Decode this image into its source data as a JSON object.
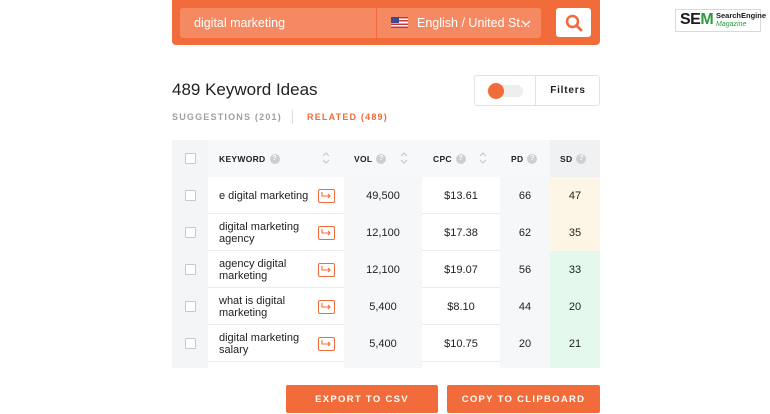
{
  "search": {
    "query": "digital marketing",
    "language": "English / United St...",
    "flag_icon": "us-flag-icon",
    "search_icon": "magnifier-icon"
  },
  "logo": {
    "sem": "SE",
    "sem_m": "M",
    "line1": "SearchEngine",
    "line2": "Magazine"
  },
  "results": {
    "title": "489 Keyword Ideas",
    "filters_label": "Filters",
    "tabs": {
      "suggestions": "SUGGESTIONS (201)",
      "related": "RELATED (489)"
    }
  },
  "table": {
    "headers": {
      "keyword": "KEYWORD",
      "vol": "VOL",
      "cpc": "CPC",
      "pd": "PD",
      "sd": "SD"
    },
    "rows": [
      {
        "keyword": "e digital marketing",
        "vol": "49,500",
        "cpc": "$13.61",
        "pd": "66",
        "sd": "47",
        "sd_color": "#fdf6e6"
      },
      {
        "keyword": "digital marketing agency",
        "vol": "12,100",
        "cpc": "$17.38",
        "pd": "62",
        "sd": "35",
        "sd_color": "#fdf6e6"
      },
      {
        "keyword": "agency digital marketing",
        "vol": "12,100",
        "cpc": "$19.07",
        "pd": "56",
        "sd": "33",
        "sd_color": "#e5f8ec"
      },
      {
        "keyword": "what is digital marketing",
        "vol": "5,400",
        "cpc": "$8.10",
        "pd": "44",
        "sd": "20",
        "sd_color": "#e5f8ec"
      },
      {
        "keyword": "digital marketing salary",
        "vol": "5,400",
        "cpc": "$10.75",
        "pd": "20",
        "sd": "21",
        "sd_color": "#e5f8ec"
      },
      {
        "keyword": "",
        "vol": "",
        "cpc": "",
        "pd": "",
        "sd": "",
        "sd_color": "#e5f8ec"
      }
    ]
  },
  "buttons": {
    "export_csv": "EXPORT TO CSV",
    "copy_clipboard": "COPY TO CLIPBOARD"
  },
  "colors": {
    "accent": "#f26b3a"
  }
}
